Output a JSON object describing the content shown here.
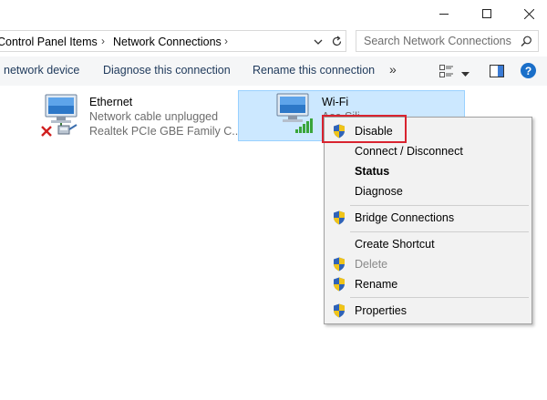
{
  "window": {
    "controls": [
      "minimize-icon",
      "maximize-icon",
      "close-icon"
    ]
  },
  "address": {
    "crumbs": [
      "Control Panel Items",
      "Network Connections"
    ],
    "search_placeholder": "Search Network Connections"
  },
  "commandbar": {
    "items": [
      "network device",
      "Diagnose this connection",
      "Rename this connection"
    ],
    "more": "»"
  },
  "connections": {
    "ethernet": {
      "name": "Ethernet",
      "status": "Network cable unplugged",
      "device": "Realtek PCIe GBE Family C..."
    },
    "wifi": {
      "name": "Wi-Fi",
      "status_partial": "Asa Sili"
    }
  },
  "context_menu": {
    "items": [
      {
        "label": "Disable",
        "shield": true
      },
      {
        "label": "Connect / Disconnect",
        "shield": false
      },
      {
        "label": "Status",
        "shield": false,
        "bold": true
      },
      {
        "label": "Diagnose",
        "shield": false
      },
      {
        "label": "Bridge Connections",
        "shield": true
      },
      {
        "label": "Create Shortcut",
        "shield": false
      },
      {
        "label": "Delete",
        "shield": true,
        "disabled": true
      },
      {
        "label": "Rename",
        "shield": true
      },
      {
        "label": "Properties",
        "shield": true
      }
    ]
  },
  "colors": {
    "selection": "#cce8ff",
    "highlight_box": "#d9232f",
    "help_icon": "#1a6fc9",
    "menu_bg": "#f2f2f2"
  }
}
